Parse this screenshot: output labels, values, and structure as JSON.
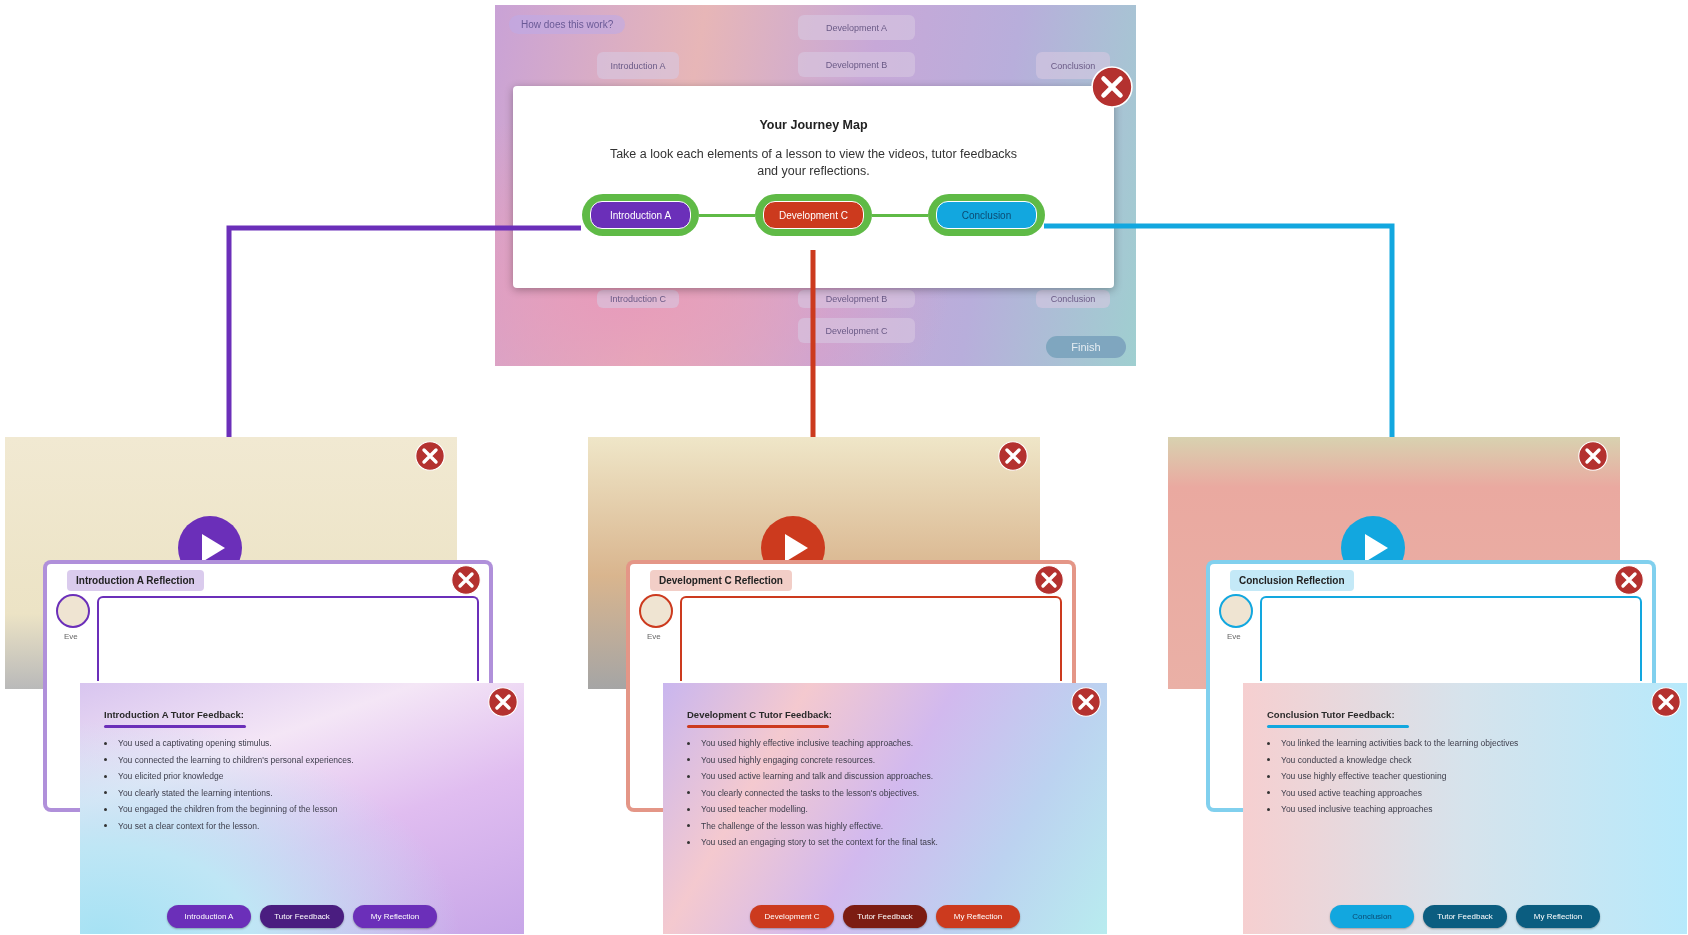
{
  "journey_map": {
    "help_button": "How does this work?",
    "background_nodes": [
      {
        "label": "Development A"
      },
      {
        "label": "Introduction A"
      },
      {
        "label": "Development B"
      },
      {
        "label": "Conclusion"
      },
      {
        "label": "Introduction C"
      },
      {
        "label": "Development B"
      },
      {
        "label": "Conclusion"
      },
      {
        "label": "Development C"
      }
    ],
    "finish_button": "Finish",
    "dialog": {
      "title": "Your Journey Map",
      "description": "Take a look each elements of a lesson to view the videos, tutor feedbacks and your reflections.",
      "nodes": [
        {
          "label": "Introduction A",
          "color": "#6b2fb9"
        },
        {
          "label": "Development C",
          "color": "#cc3a1e"
        },
        {
          "label": "Conclusion",
          "color": "#12a7df"
        }
      ]
    }
  },
  "lessons": [
    {
      "color": "#6b2fb9",
      "reflection": {
        "title": "Introduction A Reflection",
        "avatar_name": "Eve"
      },
      "feedback": {
        "title": "Introduction A Tutor Feedback:",
        "items": [
          "You used a captivating opening stimulus.",
          "You connected the learning to children's personal experiences.",
          "You elicited prior knowledge",
          "You clearly stated the learning intentions.",
          "You engaged the children from the beginning of the lesson",
          "You set a clear context for the lesson."
        ],
        "buttons": [
          {
            "label": "Introduction A",
            "color": "#6b2fb9"
          },
          {
            "label": "Tutor Feedback",
            "color": "#4a1d80"
          },
          {
            "label": "My Reflection",
            "color": "#6b2fb9"
          }
        ]
      }
    },
    {
      "color": "#cc3a1e",
      "reflection": {
        "title": "Development C Reflection",
        "avatar_name": "Eve"
      },
      "feedback": {
        "title": "Development C Tutor Feedback:",
        "items": [
          "You used highly effective inclusive teaching approaches.",
          "You used highly engaging concrete resources.",
          "You used active learning and talk and discussion approaches.",
          "You clearly connected the tasks to the lesson's objectives.",
          "You used teacher modelling.",
          "The challenge of the lesson was highly effective.",
          "You used an engaging story to set the context for the final task."
        ],
        "buttons": [
          {
            "label": "Development C",
            "color": "#cc3a1e"
          },
          {
            "label": "Tutor Feedback",
            "color": "#7c1c12"
          },
          {
            "label": "My Reflection",
            "color": "#cc3a1e"
          }
        ]
      }
    },
    {
      "color": "#12a7df",
      "reflection": {
        "title": "Conclusion Reflection",
        "avatar_name": "Eve"
      },
      "feedback": {
        "title": "Conclusion Tutor Feedback:",
        "items": [
          "You linked the learning activities back to the learning objectives",
          "You conducted a knowledge check",
          "You use highly effective teacher questioning",
          "You used active teaching approaches",
          "You used inclusive teaching approaches"
        ],
        "buttons": [
          {
            "label": "Conclusion",
            "color": "#12a7df"
          },
          {
            "label": "Tutor Feedback",
            "color": "#0b5d80"
          },
          {
            "label": "My Reflection",
            "color": "#0b5d80"
          }
        ]
      }
    }
  ]
}
